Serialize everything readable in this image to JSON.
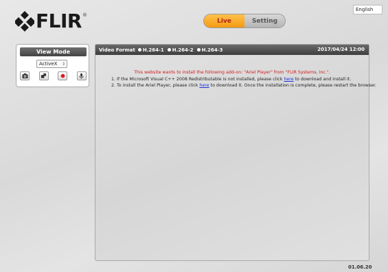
{
  "header": {
    "logo_text": "FLIR",
    "logo_reg": "®",
    "tabs": [
      {
        "label": "Live",
        "active": true
      },
      {
        "label": "Setting",
        "active": false
      }
    ],
    "language": "English"
  },
  "view_mode": {
    "title": "View Mode",
    "selected": "ActiveX",
    "buttons": [
      "snapshot-icon",
      "fullscreen-icon",
      "record-icon",
      "microphone-icon"
    ]
  },
  "video": {
    "format_label": "Video Format",
    "streams": [
      "H.264-1",
      "H.264-2",
      "H.264-3"
    ],
    "datetime": "2017/04/24 12:00",
    "notice_title": "This website wants to install the following add-on: \"Ariel Player\" from \"FLIR Systems, Inc.\".",
    "line1_pre": "1. If the Microsoft Visual C++ 2008 Redistributable is not installed, please click ",
    "line1_link": "here",
    "line1_post": " to download and install it.",
    "line2_pre": "2. To install the Ariel Player, please click ",
    "line2_link": "here",
    "line2_post": " to download it. Once the installation is complete, please restart the browser."
  },
  "version": "01.06.20",
  "colors": {
    "live_tab": "#f39a12",
    "notice_red": "#d11a1a",
    "link_blue": "#1b2fd8"
  }
}
